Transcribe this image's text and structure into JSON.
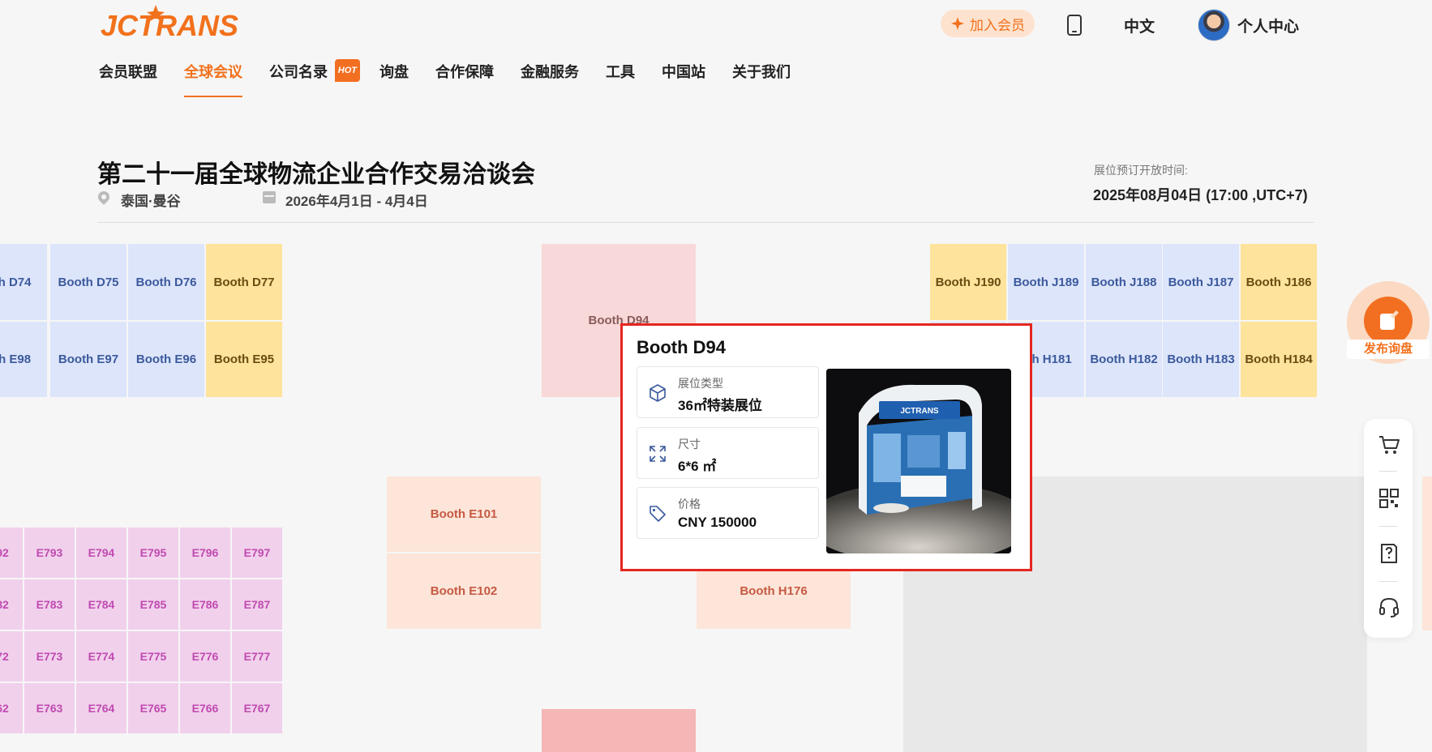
{
  "header": {
    "logo_text": "JCTRANS",
    "nav": [
      {
        "label": "会员联盟"
      },
      {
        "label": "全球会议",
        "active": true
      },
      {
        "label": "公司名录",
        "badge": "HOT"
      },
      {
        "label": "询盘"
      },
      {
        "label": "合作保障"
      },
      {
        "label": "金融服务"
      },
      {
        "label": "工具"
      },
      {
        "label": "中国站"
      },
      {
        "label": "关于我们"
      }
    ],
    "join_label": "加入会员",
    "lang_label": "中文",
    "user_label": "个人中心"
  },
  "event": {
    "title": "第二十一届全球物流企业合作交易洽谈会",
    "location": "泰国·曼谷",
    "dates": "2026年4月1日 - 4月4日",
    "open_label": "展位预订开放时间:",
    "open_time": "2025年08月04日 (17:00 ,UTC+7)"
  },
  "floorplan": {
    "left_blue_top": [
      "oth D74",
      "Booth D75",
      "Booth D76",
      "Booth D77"
    ],
    "left_blue_bottom": [
      "oth E98",
      "Booth E97",
      "Booth E96",
      "Booth E95"
    ],
    "center_pink": "Booth D94",
    "right_top": [
      "Booth J190",
      "Booth J189",
      "Booth J188",
      "Booth J187",
      "Booth J186"
    ],
    "right_bottom": [
      "oth H181",
      "Booth H182",
      "Booth H183",
      "Booth H184"
    ],
    "peach": [
      "Booth E101",
      "Booth E102",
      "Booth H176"
    ],
    "purple_rows": [
      [
        "92",
        "E793",
        "E794",
        "E795",
        "E796",
        "E797"
      ],
      [
        "82",
        "E783",
        "E784",
        "E785",
        "E786",
        "E787"
      ],
      [
        "72",
        "E773",
        "E774",
        "E775",
        "E776",
        "E777"
      ],
      [
        "62",
        "E763",
        "E764",
        "E765",
        "E766",
        "E767"
      ]
    ]
  },
  "popup": {
    "title": "Booth D94",
    "type_label": "展位类型",
    "type_value": "36㎡特装展位",
    "size_label": "尺寸",
    "size_value": "6*6 ㎡",
    "price_label": "价格",
    "price_value": "CNY 150000",
    "image_text": "JCTRANS"
  },
  "sidebar": {
    "publish_label": "发布询盘",
    "tools": [
      "cart-icon",
      "qr-code-icon",
      "question-edit-icon",
      "headset-icon"
    ]
  },
  "colors": {
    "accent": "#f2711c",
    "highlight_border": "#e52620"
  }
}
